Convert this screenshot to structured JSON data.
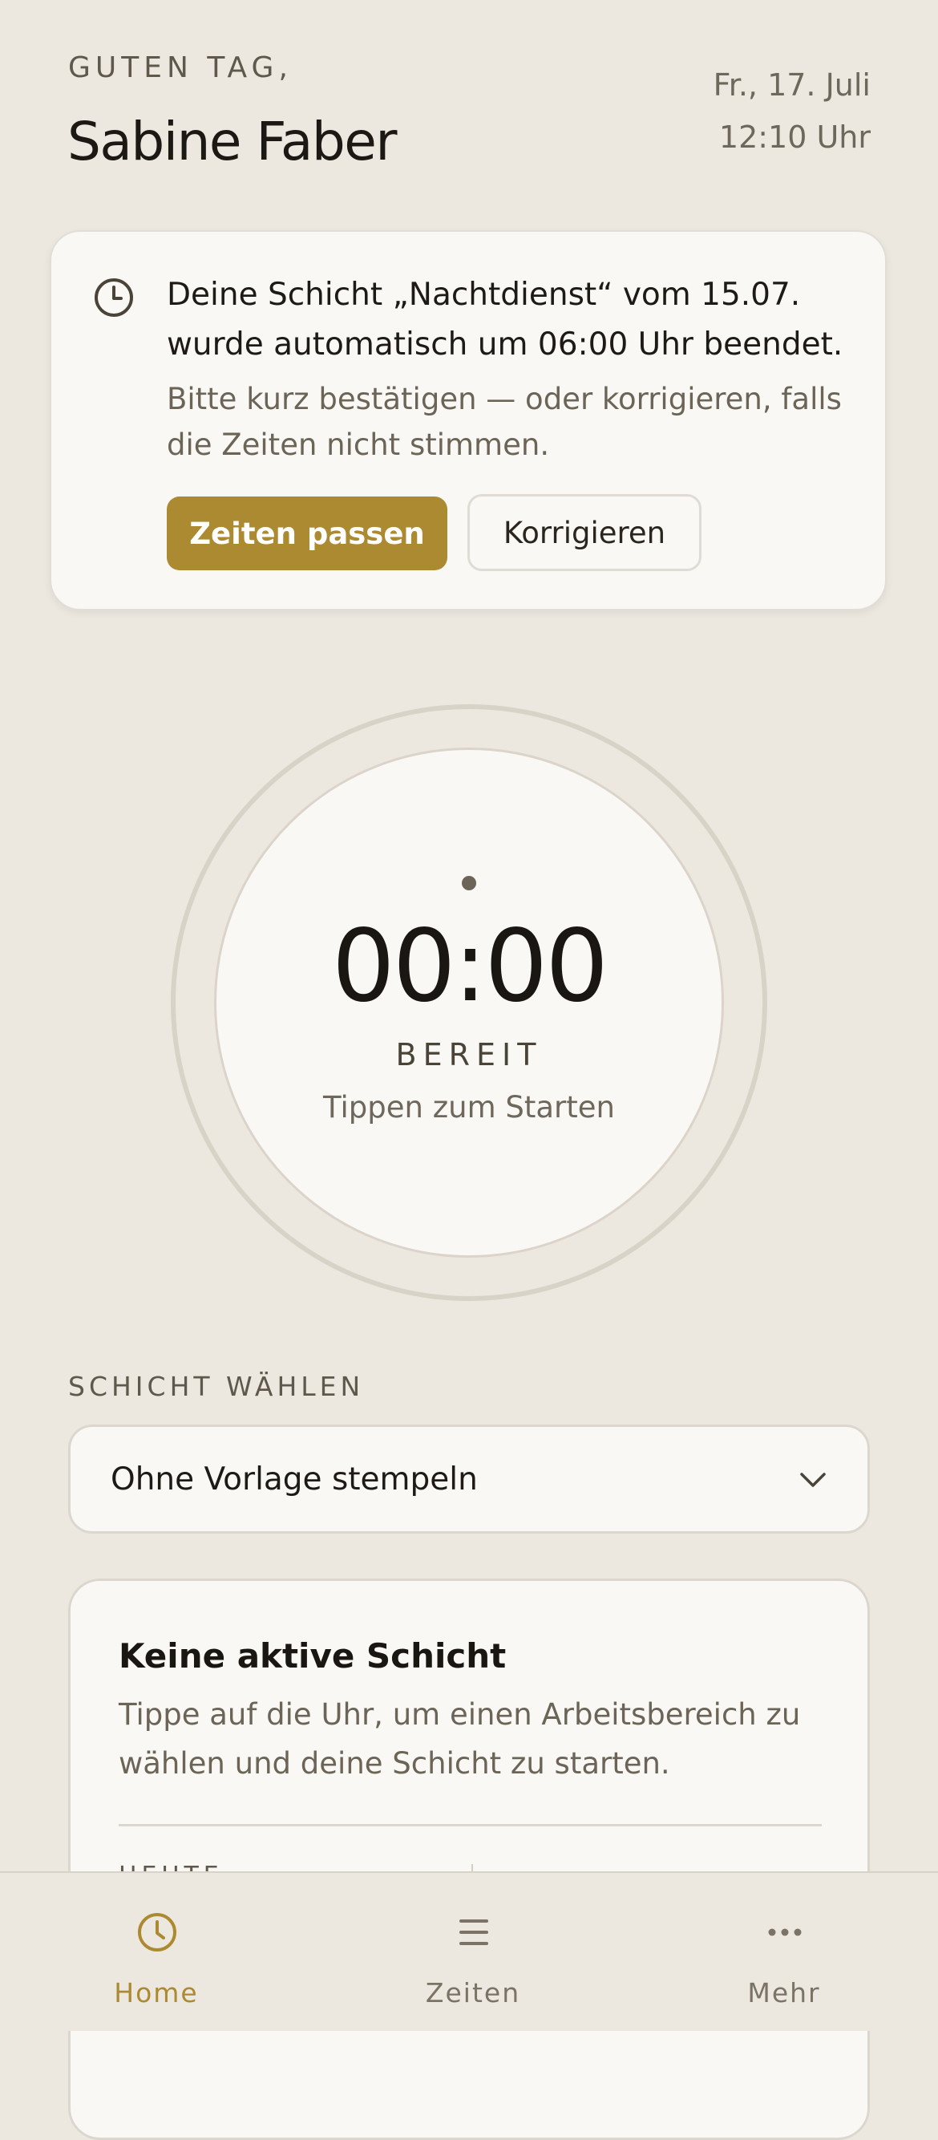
{
  "header": {
    "greeting": "GUTEN TAG,",
    "user_name": "Sabine Faber",
    "date": "Fr., 17. Juli",
    "time": "12:10 Uhr"
  },
  "notice": {
    "icon": "clock-icon",
    "title": "Deine Schicht „Nachtdienst“ vom 15.07. wurde automatisch um 06:00 Uhr beendet.",
    "subtitle": "Bitte kurz bestätigen — oder korrigieren, falls die Zeiten nicht stimmen.",
    "confirm_label": "Zeiten passen",
    "correct_label": "Korrigieren"
  },
  "clock": {
    "time": "00:00",
    "state": "BEREIT",
    "hint": "Tippen zum Starten"
  },
  "shift_select": {
    "label": "SCHICHT WÄHLEN",
    "selected": "Ohne Vorlage stempeln"
  },
  "info_card": {
    "title": "Keine aktive Schicht",
    "text": "Tippe auf die Uhr, um einen Arbeitsbereich zu wählen und deine Schicht zu starten.",
    "today_label": "HEUTE"
  },
  "tabs": [
    {
      "label": "Home",
      "icon": "clock-icon",
      "active": true
    },
    {
      "label": "Zeiten",
      "icon": "list-icon",
      "active": false
    },
    {
      "label": "Mehr",
      "icon": "more-icon",
      "active": false
    }
  ],
  "colors": {
    "background": "#ECE8E0",
    "card": "#F9F8F4",
    "accent": "#AC8A32",
    "text": "#1E1B16",
    "muted": "#6B6457"
  }
}
